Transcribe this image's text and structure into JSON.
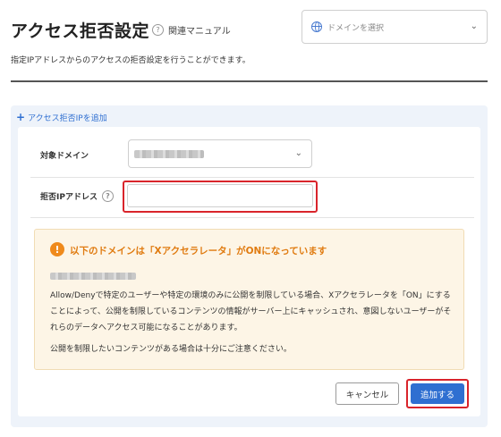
{
  "header": {
    "title": "アクセス拒否設定",
    "manual_link": "関連マニュアル",
    "domain_select_placeholder": "ドメインを選択",
    "description": "指定IPアドレスからのアクセスの拒否設定を行うことができます。"
  },
  "panel": {
    "add_link": "アクセス拒否IPを追加",
    "target_domain_label": "対象ドメイン",
    "ip_label": "拒否IPアドレス",
    "ip_value": "",
    "warning": {
      "title": "以下のドメインは「Xアクセラレータ」がONになっています",
      "body": "Allow/Denyで特定のユーザーや特定の環境のみに公開を制限している場合、Xアクセラレータを「ON」にすることによって、公開を制限しているコンテンツの情報がサーバー上にキャッシュされ、意図しないユーザーがそれらのデータへアクセス可能になることがあります。",
      "note": "公開を制限したいコンテンツがある場合は十分にご注意ください。"
    },
    "cancel_button": "キャンセル",
    "add_button": "追加する"
  },
  "colors": {
    "accent": "#2f6fd1",
    "warning": "#ef8a1c",
    "highlight_frame": "#d9242b"
  }
}
